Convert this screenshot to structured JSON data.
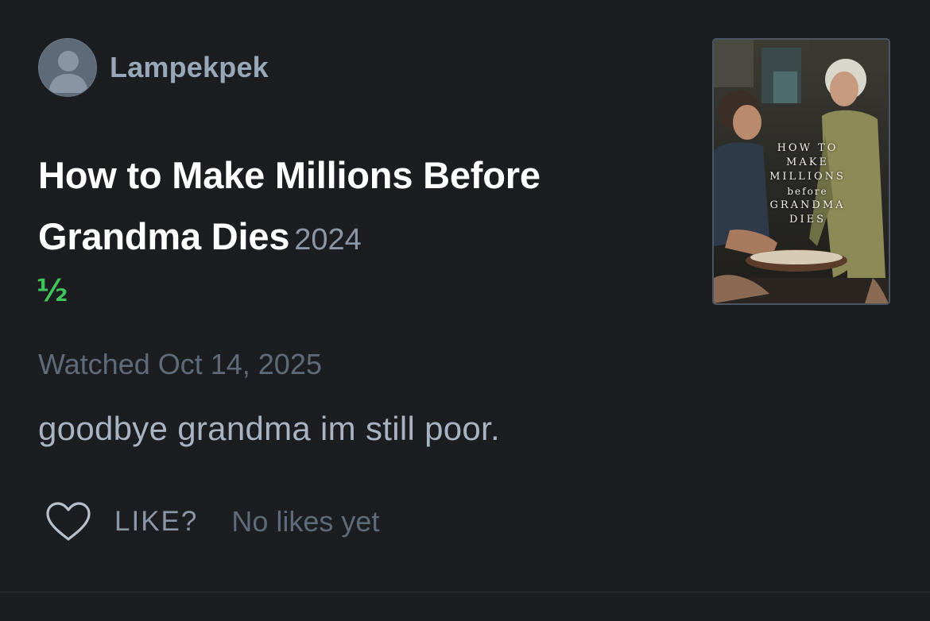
{
  "author": {
    "name": "Lampekpek",
    "avatar_icon": "user-avatar-icon"
  },
  "film": {
    "title": "How to Make Millions Before Grandma Dies",
    "year": "2024",
    "rating": "½"
  },
  "watched_text": "Watched Oct 14, 2025",
  "review_text": "goodbye grandma im still poor.",
  "like": {
    "icon": "heart-icon",
    "label": "LIKE?",
    "count_text": "No likes yet"
  },
  "poster": {
    "lines": [
      "HOW TO",
      "MAKE",
      "MILLIONS",
      "before",
      "GRANDMA",
      "DIES"
    ]
  },
  "colors": {
    "background": "#1b1d21",
    "rating": "#3fc55a",
    "title": "#ffffff",
    "muted": "#5f6b79"
  }
}
